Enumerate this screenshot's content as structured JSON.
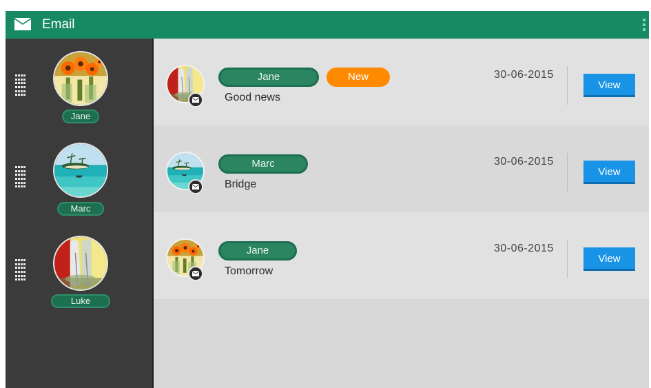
{
  "app": {
    "title": "Email"
  },
  "icons": {
    "header": "mail-icon",
    "overflow": "overflow-menu-icon",
    "drag": "drag-handle-icon",
    "badge": "mail-icon"
  },
  "colors": {
    "header": "#178a63",
    "sidebar": "#3b3b3b",
    "new_badge": "#ff8a00",
    "view_button": "#1993e6",
    "name_pill": "#2b8560"
  },
  "sidebar": {
    "contacts": [
      {
        "name": "Jane",
        "avatar": "orange-flowers"
      },
      {
        "name": "Marc",
        "avatar": "tropical-island"
      },
      {
        "name": "Luke",
        "avatar": "glass-vases"
      }
    ]
  },
  "messages": [
    {
      "sender": "Jane",
      "badge": "New",
      "subject": "Good news",
      "date": "30-06-2015",
      "action": "View",
      "avatar": "glass-vases"
    },
    {
      "sender": "Marc",
      "badge": "",
      "subject": "Bridge",
      "date": "30-06-2015",
      "action": "View",
      "avatar": "tropical-island"
    },
    {
      "sender": "Jane",
      "badge": "",
      "subject": "Tomorrow",
      "date": "30-06-2015",
      "action": "View",
      "avatar": "orange-flowers"
    }
  ]
}
